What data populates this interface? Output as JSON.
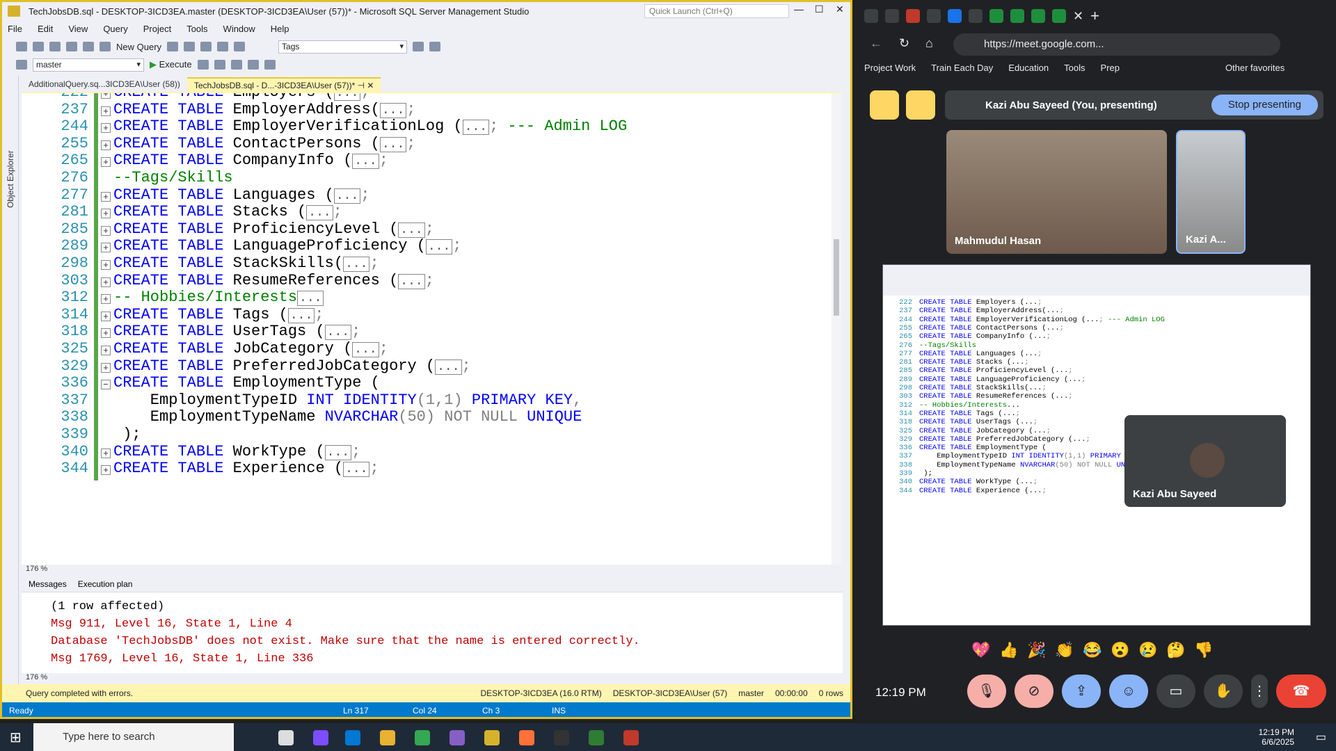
{
  "ssms": {
    "title": "TechJobsDB.sql - DESKTOP-3ICD3EA.master (DESKTOP-3ICD3EA\\User (57))* - Microsoft SQL Server Management Studio",
    "quick_launch": "Quick Launch (Ctrl+Q)",
    "menu": [
      "File",
      "Edit",
      "View",
      "Query",
      "Project",
      "Tools",
      "Window",
      "Help"
    ],
    "toolbar": {
      "new_query": "New Query",
      "execute": "Execute",
      "db_combo": "master",
      "tags_combo": "Tags"
    },
    "object_explorer": "Object Explorer",
    "tabs": [
      "AdditionalQuery.sq...3ICD3EA\\User (58))",
      "TechJobsDB.sql - D...-3ICD3EA\\User (57))*"
    ],
    "code_lines": [
      {
        "n": "222",
        "pre": "CREATE TABLE ",
        "name": "Employers (",
        "box": "...",
        "post": ";"
      },
      {
        "n": "237",
        "pre": "CREATE TABLE ",
        "name": "EmployerAddress(",
        "box": "...",
        "post": ";"
      },
      {
        "n": "244",
        "pre": "CREATE TABLE ",
        "name": "EmployerVerificationLog (",
        "box": "...",
        "post": "; ",
        "comment": "--- Admin LOG"
      },
      {
        "n": "255",
        "pre": "CREATE TABLE ",
        "name": "ContactPersons (",
        "box": "...",
        "post": ";"
      },
      {
        "n": "265",
        "pre": "CREATE TABLE ",
        "name": "CompanyInfo (",
        "box": "...",
        "post": ";"
      },
      {
        "n": "276",
        "comment_line": "--Tags/Skills"
      },
      {
        "n": "277",
        "pre": "CREATE TABLE ",
        "name": "Languages (",
        "box": "...",
        "post": ";"
      },
      {
        "n": "281",
        "pre": "CREATE TABLE ",
        "name": "Stacks (",
        "box": "...",
        "post": ";"
      },
      {
        "n": "285",
        "pre": "CREATE TABLE ",
        "name": "ProficiencyLevel (",
        "box": "...",
        "post": ";"
      },
      {
        "n": "289",
        "pre": "CREATE TABLE ",
        "name": "LanguageProficiency (",
        "box": "...",
        "post": ";"
      },
      {
        "n": "298",
        "pre": "CREATE TABLE ",
        "name": "StackSkills(",
        "box": "...",
        "post": ";"
      },
      {
        "n": "303",
        "pre": "CREATE TABLE ",
        "name": "ResumeReferences (",
        "box": "...",
        "post": ";"
      },
      {
        "n": "312",
        "comment_line": "-- Hobbies/Interests",
        "box": "..."
      },
      {
        "n": "314",
        "pre": "CREATE TABLE ",
        "name": "Tags (",
        "box": "...",
        "post": ";"
      },
      {
        "n": "318",
        "pre": "CREATE TABLE ",
        "name": "UserTags (",
        "box": "...",
        "post": ";"
      },
      {
        "n": "325",
        "pre": "CREATE TABLE ",
        "name": "JobCategory (",
        "box": "...",
        "post": ";"
      },
      {
        "n": "329",
        "pre": "CREATE TABLE ",
        "name": "PreferredJobCategory (",
        "box": "...",
        "post": ";"
      },
      {
        "n": "336",
        "pre": "CREATE TABLE ",
        "name": "EmploymentType (",
        "box": "",
        "post": ""
      },
      {
        "n": "337",
        "col1": "    EmploymentTypeID ",
        "kw1": "INT IDENTITY",
        "mid": "(1,1) ",
        "kw2": "PRIMARY KEY",
        ",": ","
      },
      {
        "n": "338",
        "col1": "    EmploymentTypeName ",
        "kw1": "NVARCHAR",
        "mid": "(50) ",
        "gr": "NOT NULL ",
        "kw2": "UNIQUE"
      },
      {
        "n": "339",
        "plain": ");"
      },
      {
        "n": "340",
        "pre": "CREATE TABLE ",
        "name": "WorkType (",
        "box": "...",
        "post": ";"
      },
      {
        "n": "344",
        "pre": "CREATE TABLE ",
        "name": "Experience (",
        "box": "...",
        "post": ";"
      }
    ],
    "zoom": "176 %",
    "results_tabs": [
      "Messages",
      "Execution plan"
    ],
    "messages": [
      "(1 row affected)",
      "Msg 911, Level 16, State 1, Line 4",
      "Database 'TechJobsDB' does not exist. Make sure that the name is entered correctly.",
      "Msg 1769, Level 16, State 1, Line 336"
    ],
    "query_status": "Query completed with errors.",
    "server": "DESKTOP-3ICD3EA (16.0 RTM)",
    "user": "DESKTOP-3ICD3EA\\User (57)",
    "db": "master",
    "elapsed": "00:00:00",
    "rows": "0 rows",
    "status": {
      "ready": "Ready",
      "ln": "Ln 317",
      "col": "Col 24",
      "ch": "Ch 3",
      "mode": "INS"
    }
  },
  "browser": {
    "url": "https://meet.google.com...",
    "bookmarks": [
      "Project Work",
      "Train Each Day",
      "Education",
      "Tools",
      "Prep",
      "Other favorites"
    ],
    "presenting": "Kazi Abu Sayeed (You, presenting)",
    "stop_presenting": "Stop presenting",
    "participant1": "Mahmudul Hasan",
    "participant2": "Kazi A...",
    "pip_name": "Kazi Abu Sayeed",
    "time": "12:19 PM",
    "reactions": [
      "💖",
      "👍",
      "🎉",
      "👏",
      "😂",
      "😮",
      "😢",
      "🤔",
      "👎"
    ]
  },
  "taskbar": {
    "search": "Type here to search",
    "time": "12:19 PM",
    "date": "6/6/2025"
  }
}
